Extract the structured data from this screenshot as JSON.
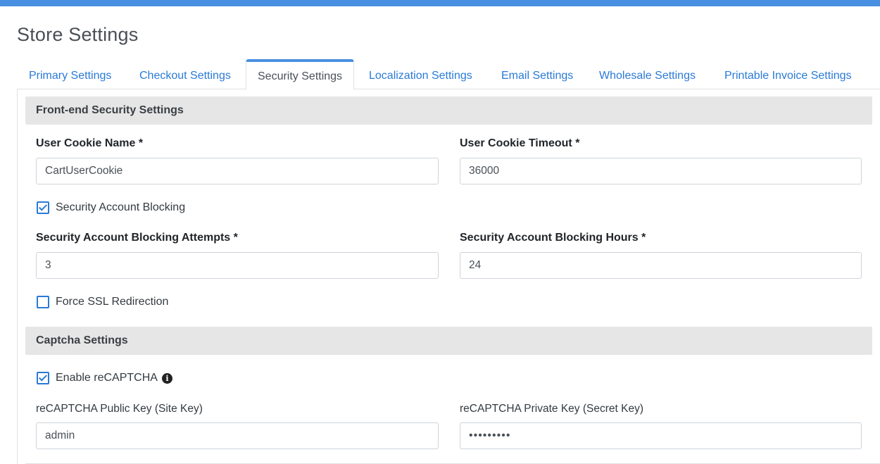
{
  "page": {
    "title": "Store Settings"
  },
  "tabs": [
    {
      "label": "Primary Settings",
      "active": false
    },
    {
      "label": "Checkout Settings",
      "active": false
    },
    {
      "label": "Security Settings",
      "active": true
    },
    {
      "label": "Localization Settings",
      "active": false
    },
    {
      "label": "Email Settings",
      "active": false
    },
    {
      "label": "Wholesale Settings",
      "active": false
    },
    {
      "label": "Printable Invoice Settings",
      "active": false
    }
  ],
  "frontend": {
    "header": "Front-end Security Settings",
    "cookie_name": {
      "label": "User Cookie Name *",
      "value": "CartUserCookie"
    },
    "cookie_timeout": {
      "label": "User Cookie Timeout *",
      "value": "36000"
    },
    "account_blocking": {
      "label": "Security Account Blocking",
      "checked": true
    },
    "blocking_attempts": {
      "label": "Security Account Blocking Attempts *",
      "value": "3"
    },
    "blocking_hours": {
      "label": "Security Account Blocking Hours *",
      "value": "24"
    },
    "force_ssl": {
      "label": "Force SSL Redirection",
      "checked": false
    }
  },
  "captcha": {
    "header": "Captcha Settings",
    "enable": {
      "label": "Enable reCAPTCHA",
      "checked": true,
      "info_icon": "info-circle-icon"
    },
    "public_key": {
      "label": "reCAPTCHA Public Key (Site Key)",
      "value": "admin"
    },
    "private_key": {
      "label": "reCAPTCHA Private Key (Secret Key)",
      "value": "•••••••••"
    }
  },
  "colors": {
    "accent": "#4a90e2",
    "link": "#2a7ad6",
    "section_bg": "#e6e6e6",
    "border": "#ced4da"
  }
}
